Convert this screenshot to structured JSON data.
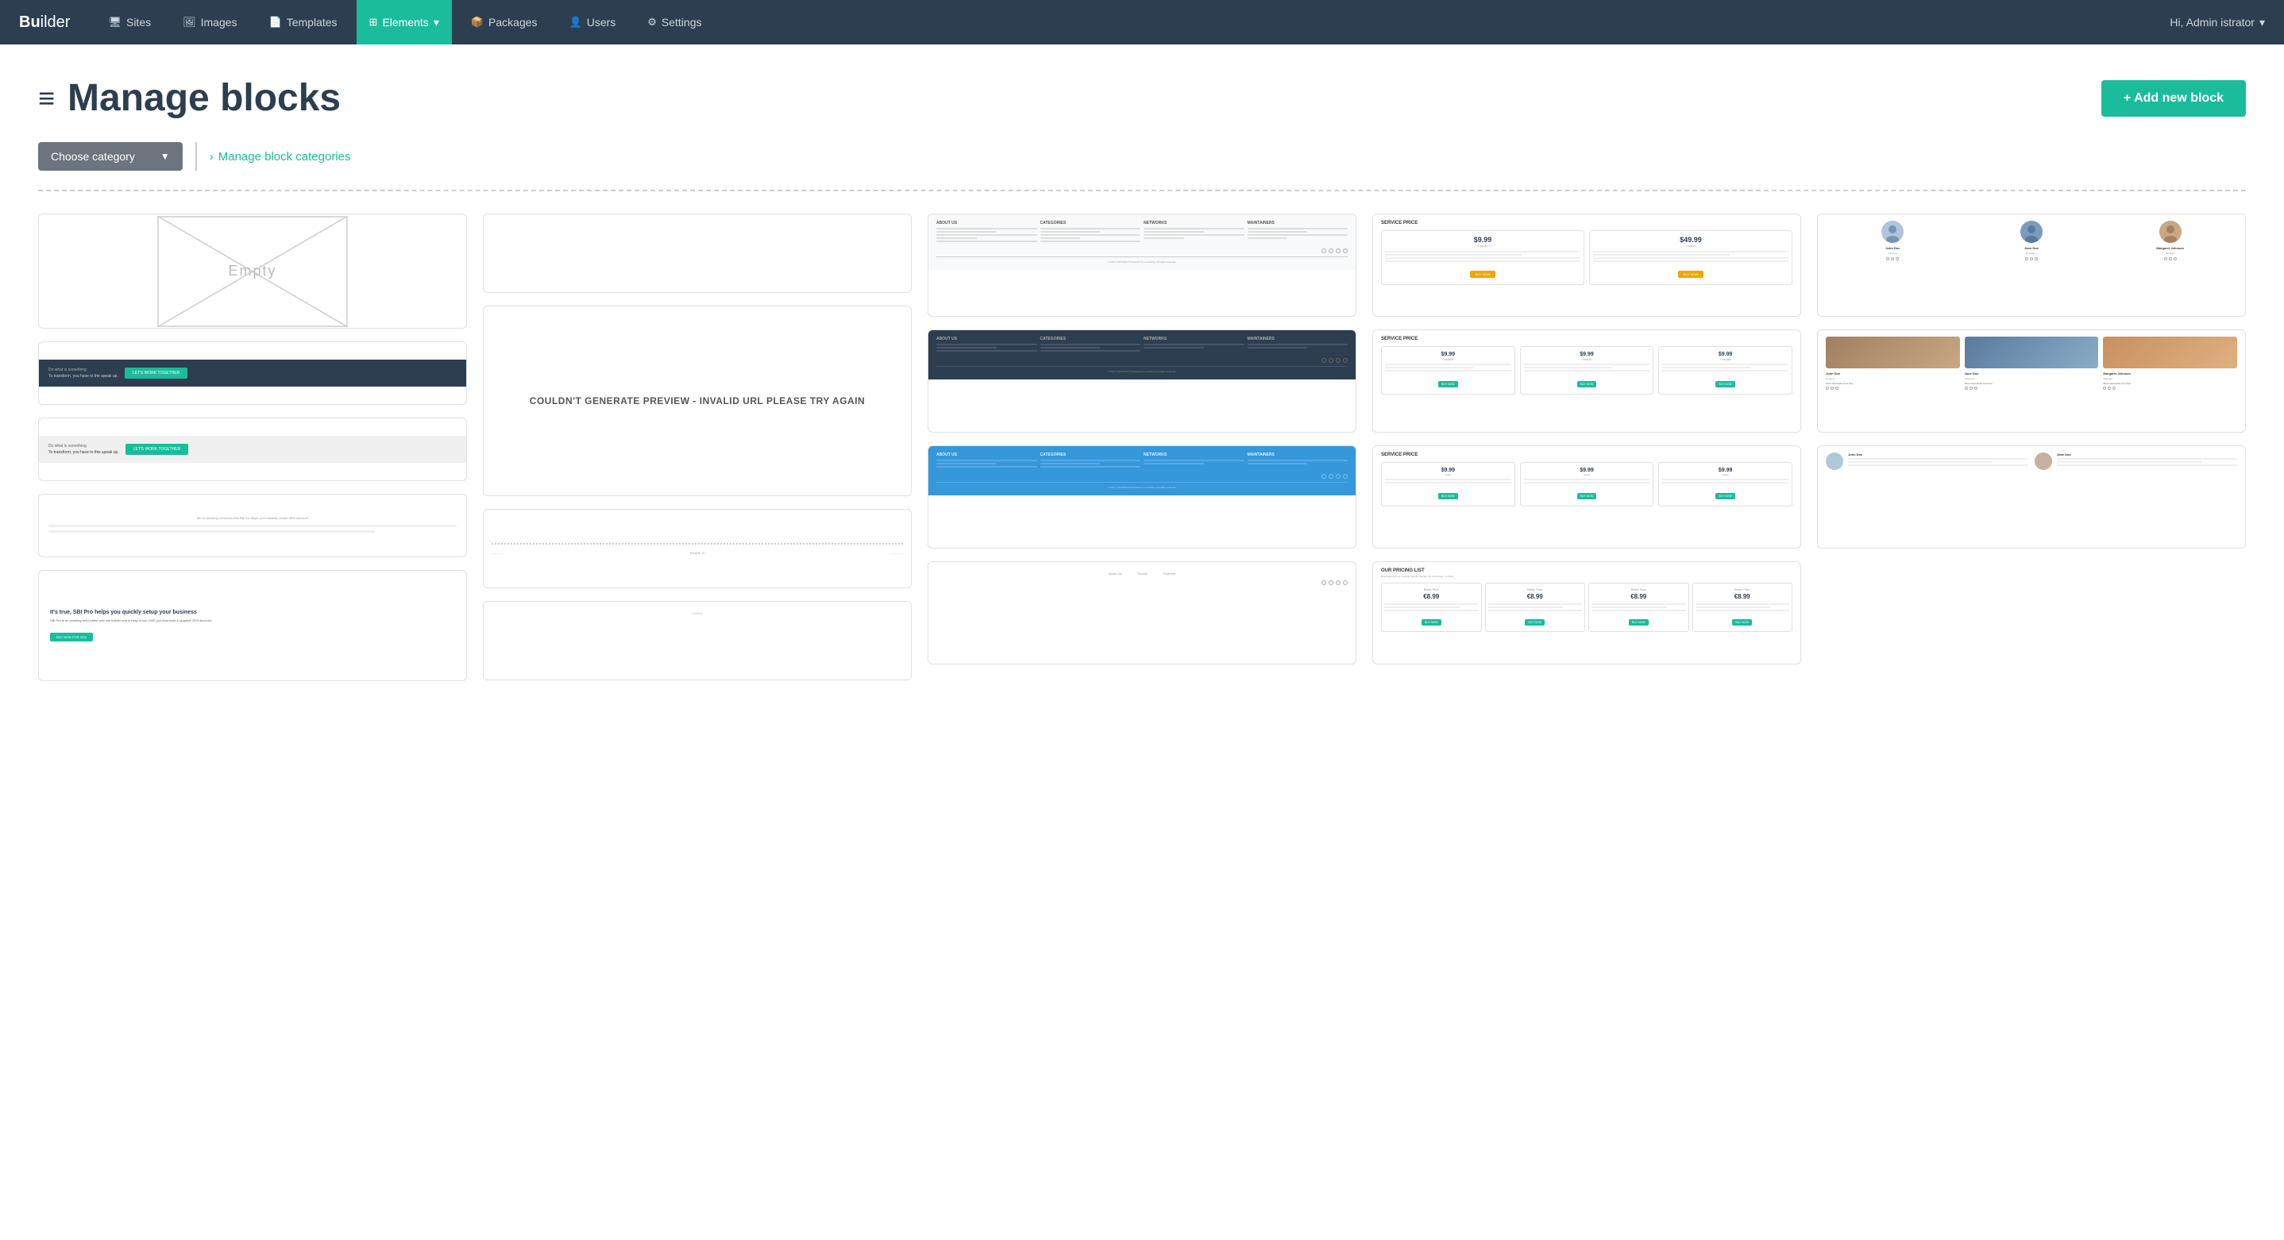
{
  "nav": {
    "brand": "Builder",
    "brand_bold": "Bu",
    "items": [
      {
        "label": "Sites",
        "icon": "🖥",
        "active": false
      },
      {
        "label": "Images",
        "icon": "🖼",
        "active": false
      },
      {
        "label": "Templates",
        "icon": "📄",
        "active": false
      },
      {
        "label": "Elements",
        "icon": "⊞",
        "active": true
      },
      {
        "label": "Packages",
        "icon": "📦",
        "active": false
      },
      {
        "label": "Users",
        "icon": "👤",
        "active": false
      },
      {
        "label": "Settings",
        "icon": "⚙",
        "active": false
      }
    ],
    "user": "Hi, Admin istrator",
    "dropdown_arrow": "▾"
  },
  "page": {
    "title": "Manage blocks",
    "title_icon": "≡",
    "add_button": "+ Add new block",
    "category_placeholder": "Choose category",
    "manage_link": "Manage block categories",
    "manage_arrow": "›"
  },
  "blocks": {
    "invalid_url_text": "COULDN'T GENERATE PREVIEW - INVALID URL PLEASE TRY AGAIN"
  }
}
